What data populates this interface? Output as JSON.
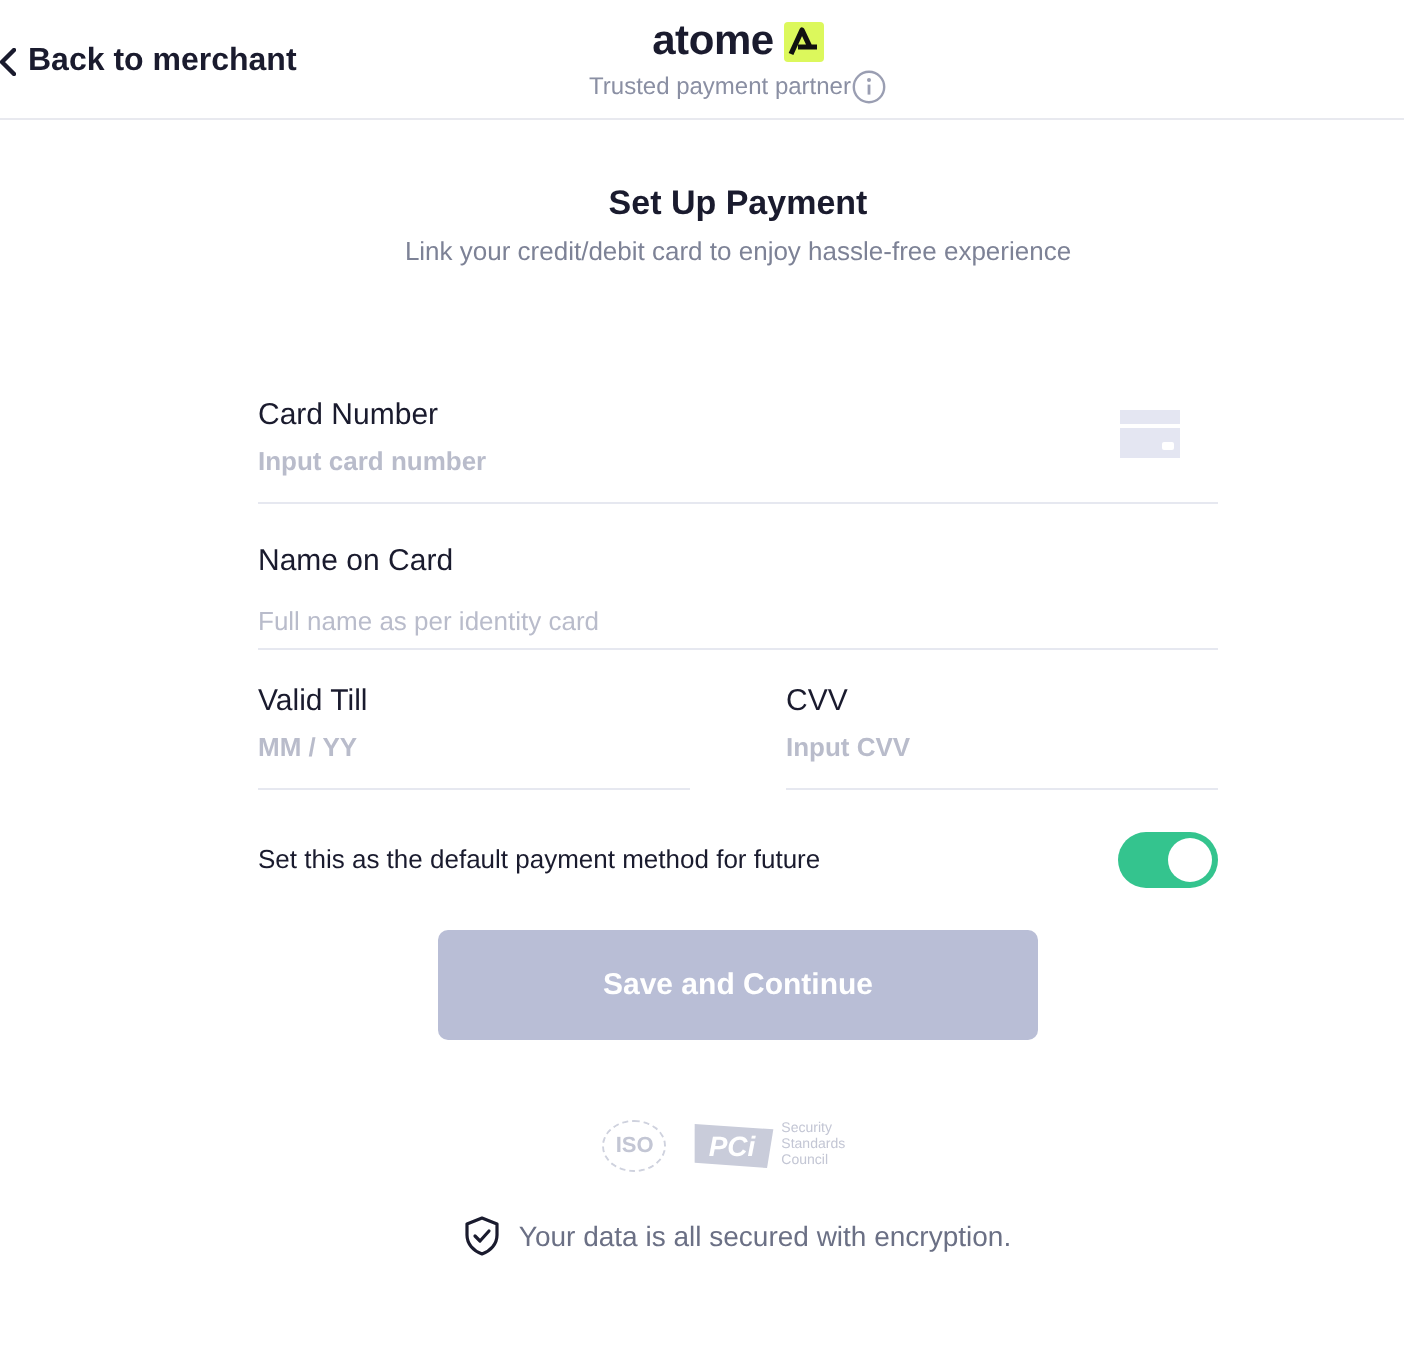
{
  "header": {
    "back_link": "Back to merchant",
    "brand": "atome",
    "tagline": "Trusted payment partner"
  },
  "intro": {
    "title": "Set Up Payment",
    "subtitle": "Link your credit/debit card to enjoy hassle-free experience"
  },
  "fields": [
    {
      "kind": "card",
      "label": "Card Number",
      "placeholder": "Input card number"
    },
    {
      "kind": "name",
      "label": "Name on Card",
      "placeholder": "Full name as per identity card"
    },
    {
      "kind": "expiry",
      "label": "Valid Till",
      "placeholder": "MM / YY"
    },
    {
      "kind": "cvv",
      "label": "CVV",
      "placeholder": "Input CVV"
    }
  ],
  "default_toggle": {
    "label": "Set this as the default payment method for future",
    "on": true
  },
  "submit_button": {
    "label": "Save and Continue",
    "disabled": true
  },
  "certifications": [
    {
      "kind": "iso",
      "text": "ISO"
    },
    {
      "kind": "pci",
      "text": "PCi",
      "caption": "Security Standards Council"
    }
  ],
  "security_note": "Your data is all secured with encryption."
}
